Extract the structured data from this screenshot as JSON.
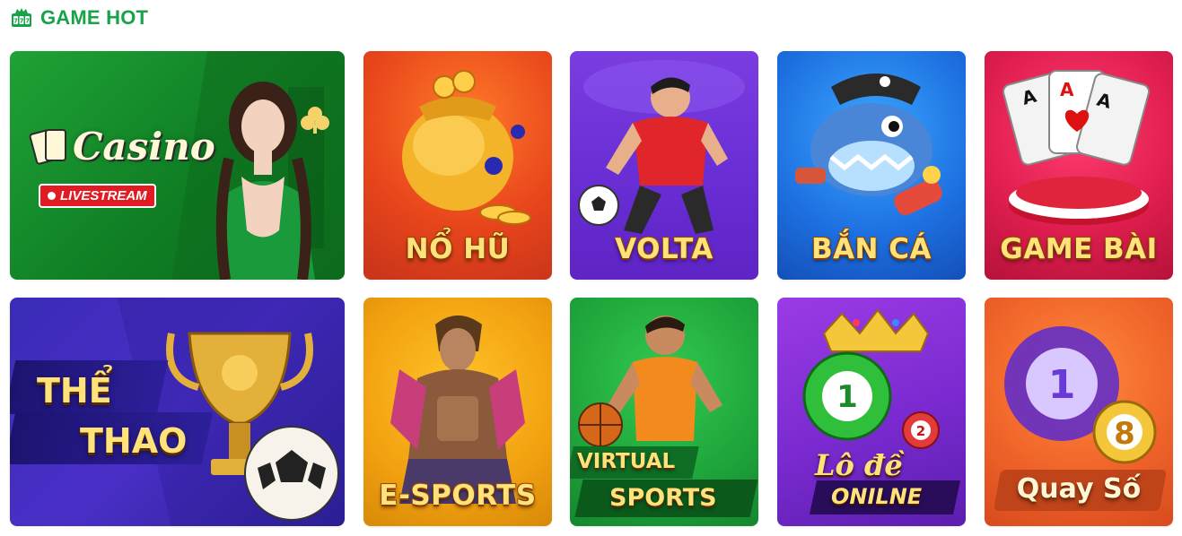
{
  "section": {
    "title": "GAME HOT",
    "icon": "slot-machine-icon"
  },
  "tiles": [
    {
      "id": "casino",
      "title": "Casino",
      "badge": "LIVESTREAM"
    },
    {
      "id": "nohu",
      "title": "NỔ HŨ"
    },
    {
      "id": "volta",
      "title": "VOLTA"
    },
    {
      "id": "banca",
      "title": "BẮN CÁ"
    },
    {
      "id": "gamebai",
      "title": "GAME BÀI"
    },
    {
      "id": "thethao",
      "title_line1": "THỂ",
      "title_line2": "THAO"
    },
    {
      "id": "esports",
      "title": "E-SPORTS"
    },
    {
      "id": "virtual",
      "title_line1": "VIRTUAL",
      "title_line2": "SPORTS"
    },
    {
      "id": "lode",
      "title_line1": "Lô đề",
      "title_line2": "ONILNE",
      "ball_numbers": [
        "1",
        "2"
      ]
    },
    {
      "id": "quayso",
      "title": "Quay Số",
      "ball_numbers": [
        "1",
        "8"
      ]
    }
  ],
  "colors": {
    "accent": "#18a34a"
  }
}
